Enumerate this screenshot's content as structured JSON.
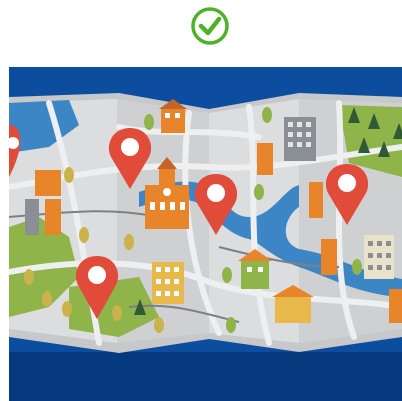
{
  "status": {
    "icon": "check-circle-icon",
    "color": "#4fb02a"
  },
  "illustration": {
    "subject": "folded-city-map-icon",
    "pin_icon": "map-pin-icon",
    "pin_count": 5,
    "colors": {
      "background": "#0d4da0",
      "paper": "#d9dadb",
      "water": "#3d86c6",
      "park": "#8fb44a",
      "pin": "#e04b3a",
      "building_orange": "#e8842a",
      "building_grey": "#8a8f96"
    }
  }
}
